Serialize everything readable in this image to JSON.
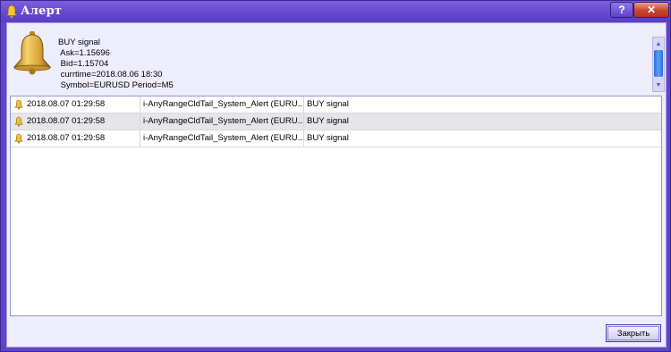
{
  "window": {
    "title": "Алерт",
    "help_label": "?",
    "close_label": "✕"
  },
  "message": {
    "text": "BUY signal\n Ask=1.15696\n Bid=1.15704\n currtime=2018.08.06 18:30\n Symbol=EURUSD Period=M5"
  },
  "alerts": [
    {
      "time": "2018.08.07 01:29:58",
      "name": "i-AnyRangeCldTail_System_Alert (EURU...",
      "message": "BUY signal"
    },
    {
      "time": "2018.08.07 01:29:58",
      "name": "i-AnyRangeCldTail_System_Alert (EURU...",
      "message": "BUY signal"
    },
    {
      "time": "2018.08.07 01:29:58",
      "name": "i-AnyRangeCldTail_System_Alert (EURU...",
      "message": "BUY signal"
    }
  ],
  "buttons": {
    "close": "Закрыть"
  },
  "icons": {
    "title": "bell-icon",
    "message": "bell-icon",
    "row": "bell-icon"
  },
  "colors": {
    "frame": "#5f44c9",
    "client": "#ededfb",
    "selected_row": "#e5e5ea",
    "close_button": "#c8452f"
  }
}
